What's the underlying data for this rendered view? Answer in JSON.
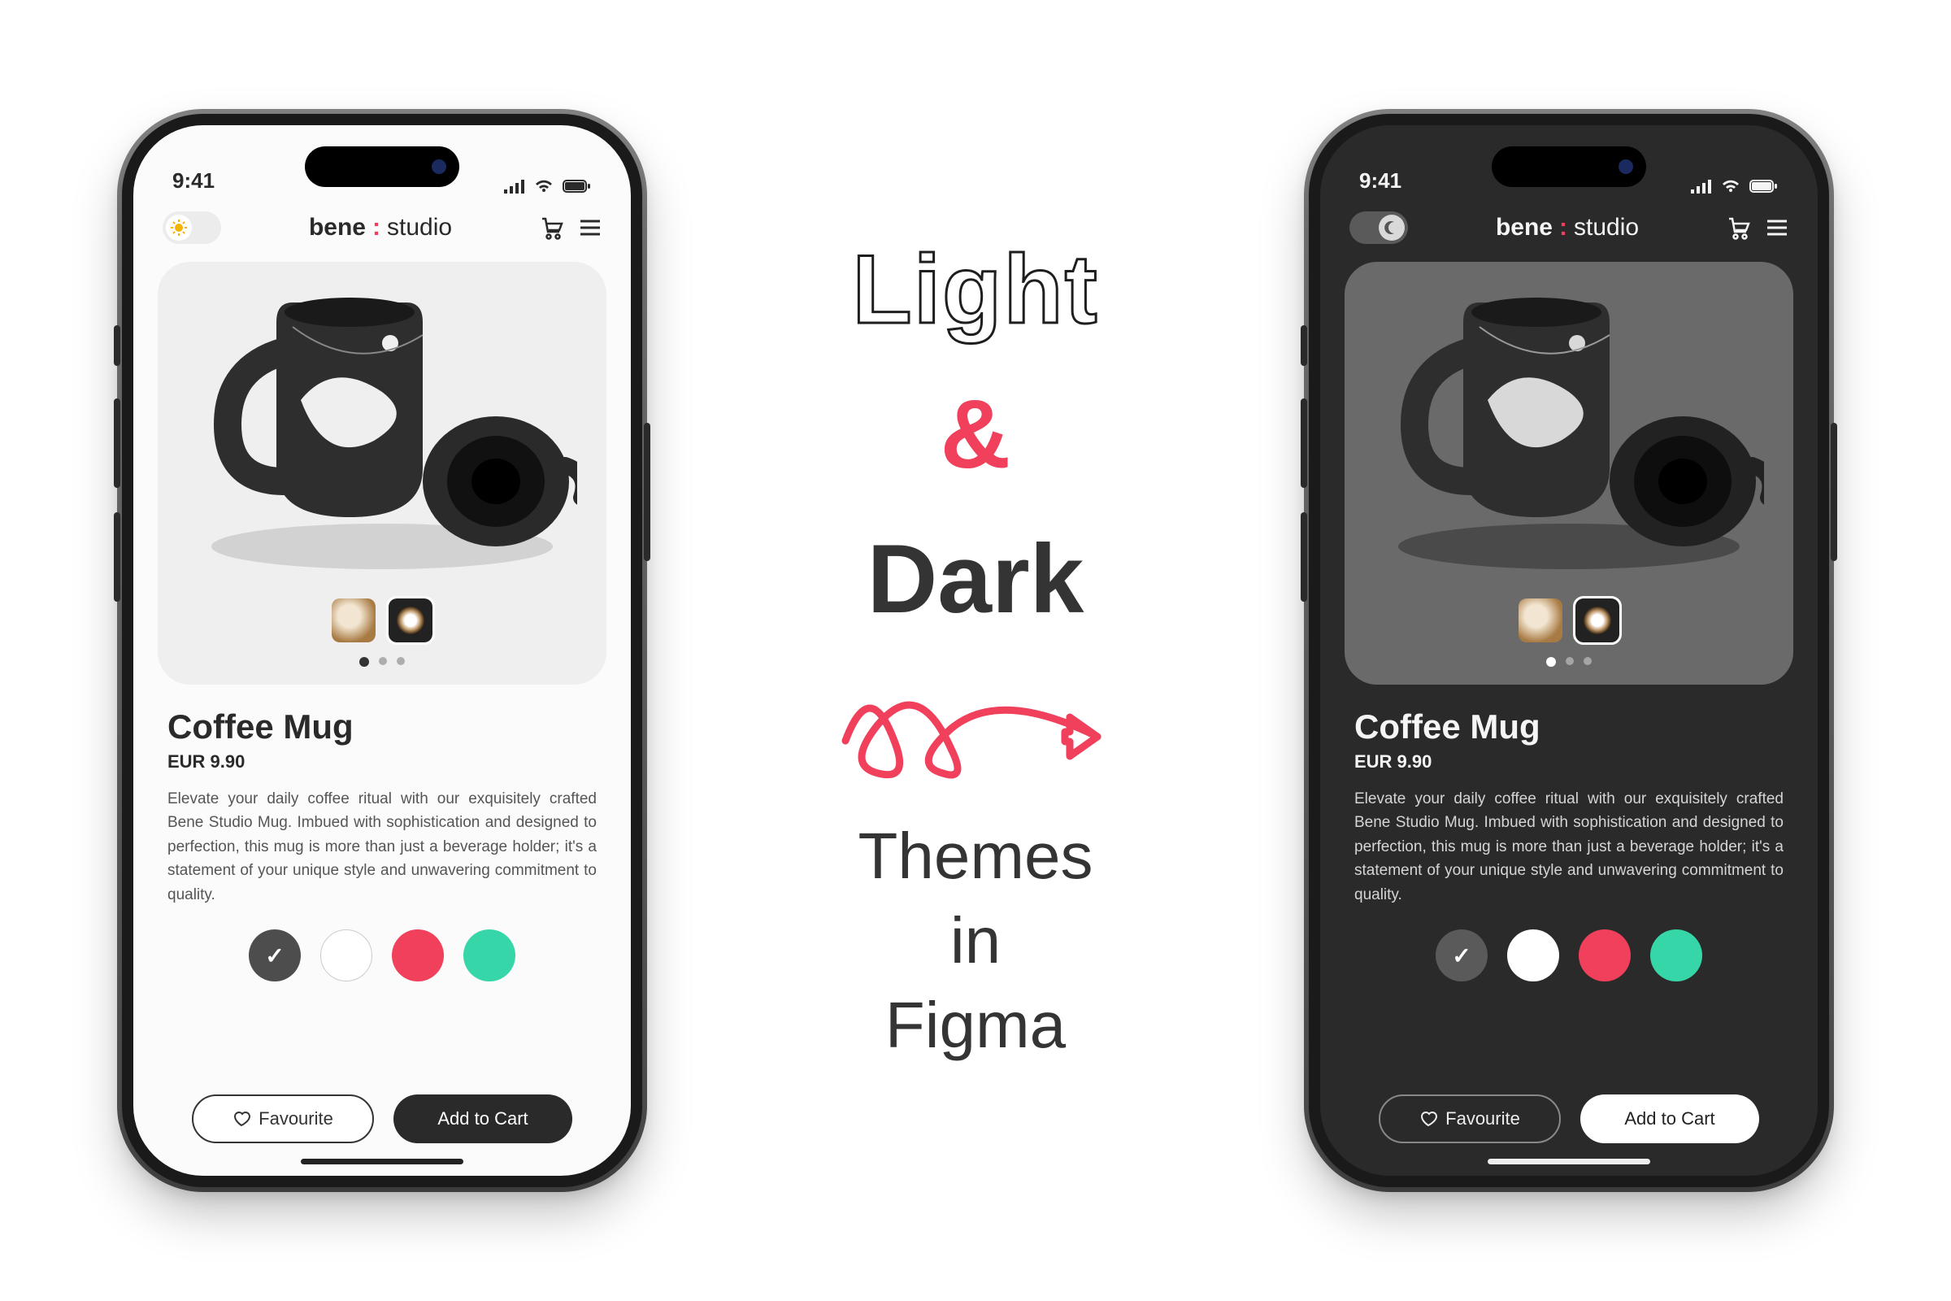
{
  "center_text": {
    "light": "Light",
    "amp": "&",
    "dark": "Dark",
    "themes_line1": "Themes",
    "themes_line2": "in",
    "themes_line3": "Figma"
  },
  "colors": {
    "accent": "#f0405b",
    "teal": "#36d6a9",
    "dark_gray": "#4d4d4d",
    "white": "#ffffff"
  },
  "phones": {
    "light": {
      "status_time": "9:41",
      "brand_bene": "bene",
      "brand_colon": ":",
      "brand_studio": "studio",
      "product_title": "Coffee Mug",
      "product_price": "EUR 9.90",
      "product_desc": "Elevate your daily coffee ritual with our exquisitely crafted Bene Studio Mug. Imbued with sophistication and designed to perfection, this mug is more than just a beverage holder; it's a statement of your unique style and unwavering commitment to quality.",
      "favourite_label": "Favourite",
      "cart_label": "Add to Cart",
      "pager_active_index": 0,
      "pager_count": 3,
      "selected_swatch_index": 0
    },
    "dark": {
      "status_time": "9:41",
      "brand_bene": "bene",
      "brand_colon": ":",
      "brand_studio": "studio",
      "product_title": "Coffee Mug",
      "product_price": "EUR 9.90",
      "product_desc": "Elevate your daily coffee ritual with our exquisitely crafted Bene Studio Mug. Imbued with sophistication and designed to perfection, this mug is more than just a beverage holder; it's a statement of your unique style and unwavering commitment to quality.",
      "favourite_label": "Favourite",
      "cart_label": "Add to Cart",
      "pager_active_index": 0,
      "pager_count": 3,
      "selected_swatch_index": 0
    }
  },
  "swatch_colors": [
    "#4d4d4d",
    "#ffffff",
    "#f0405b",
    "#36d6a9"
  ]
}
